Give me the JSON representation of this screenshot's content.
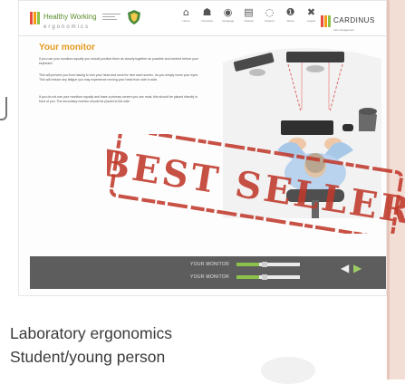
{
  "header": {
    "logo_name": "Healthy Working",
    "logo_sub": "ergonomics",
    "nav": [
      {
        "icon": "home-icon",
        "glyph": "⌂",
        "label": "Home"
      },
      {
        "icon": "people-icon",
        "glyph": "☗",
        "label": "Overview"
      },
      {
        "icon": "globe-icon",
        "glyph": "◉",
        "label": "Language"
      },
      {
        "icon": "document-icon",
        "glyph": "▤",
        "label": "Tutorial"
      },
      {
        "icon": "help-icon",
        "glyph": "◌",
        "label": "Support"
      },
      {
        "icon": "info-icon",
        "glyph": "❶",
        "label": "About"
      },
      {
        "icon": "close-icon",
        "glyph": "✖",
        "label": "Logout"
      }
    ],
    "brand": "CARDINUS",
    "brand_sub": "risk management"
  },
  "main": {
    "title": "Your monitor",
    "paragraphs": [
      "If you use your monitors equally you should position them as closely together as possible and centred before your keyboard.",
      "This will prevent you from having to turn your head and neck for new each screen, as you simply move your eyes. This will reduce any fatigue you may experience moving your head from side to side.",
      "If you do not use your monitors equally and have a primary screen you use most, this should be placed directly in front of you. The secondary monitor should be placed to the side."
    ]
  },
  "controls": [
    {
      "label": "YOUR MONITOR",
      "fill_fraction": 0.35
    },
    {
      "label": "YOUR MONITOR",
      "fill_fraction": 0.35
    }
  ],
  "stamp_text": "BEST SELLER",
  "captions": [
    "Laboratory ergonomics",
    "Student/young person"
  ],
  "colors": {
    "accent": "#e39a1f",
    "stamp": "#c0392b",
    "control_bar": "#5d5d5d",
    "slider_fill": "#8bc34a",
    "logo_bars": [
      "#e74c3c",
      "#f39c12",
      "#8bc34a"
    ],
    "brand_bars": [
      "#e74c3c",
      "#f39c12",
      "#8bc34a"
    ]
  }
}
